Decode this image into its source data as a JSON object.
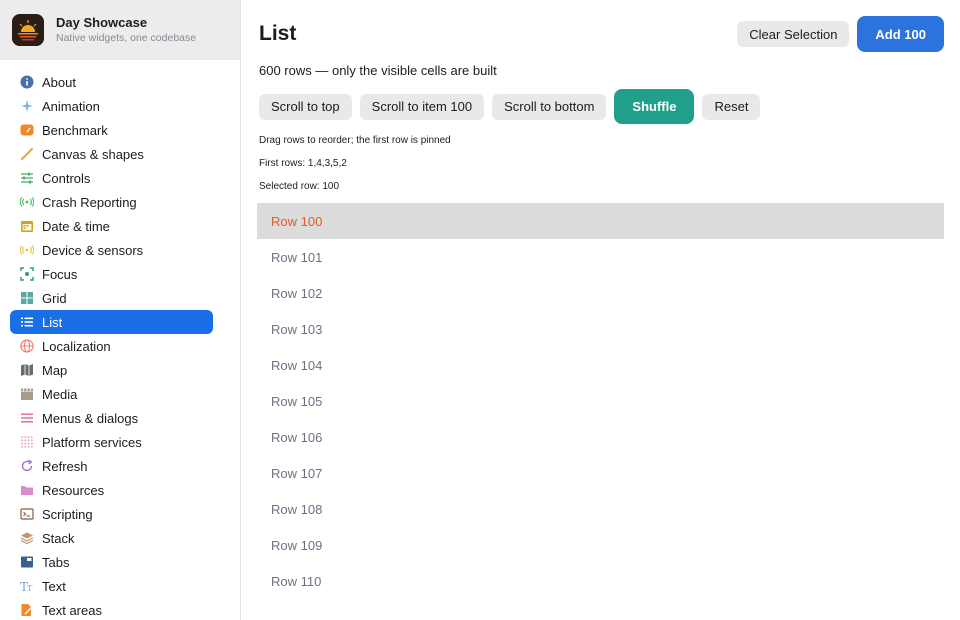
{
  "brand": {
    "title": "Day Showcase",
    "subtitle": "Native widgets, one codebase"
  },
  "sidebar": {
    "items": [
      {
        "label": "About",
        "icon": "info-icon",
        "color": "#4a6fa5"
      },
      {
        "label": "Animation",
        "icon": "sparkle-icon",
        "color": "#7fb3e8"
      },
      {
        "label": "Benchmark",
        "icon": "gauge-icon",
        "color": "#f0892b"
      },
      {
        "label": "Canvas & shapes",
        "icon": "brush-icon",
        "color": "#f0a640"
      },
      {
        "label": "Controls",
        "icon": "sliders-icon",
        "color": "#4caf6a"
      },
      {
        "label": "Crash Reporting",
        "icon": "broadcast-icon",
        "color": "#4cb85c"
      },
      {
        "label": "Date & time",
        "icon": "calendar-icon",
        "color": "#c9a227"
      },
      {
        "label": "Device & sensors",
        "icon": "sensor-icon",
        "color": "#e8c23a"
      },
      {
        "label": "Focus",
        "icon": "focus-icon",
        "color": "#2e9c8a"
      },
      {
        "label": "Grid",
        "icon": "grid-icon",
        "color": "#5aa9a0"
      },
      {
        "label": "List",
        "icon": "list-icon",
        "color": "#ffffff",
        "active": true
      },
      {
        "label": "Localization",
        "icon": "globe-icon",
        "color": "#ef7e6a"
      },
      {
        "label": "Map",
        "icon": "map-icon",
        "color": "#6b6b6b"
      },
      {
        "label": "Media",
        "icon": "clapper-icon",
        "color": "#a89a8c"
      },
      {
        "label": "Menus & dialogs",
        "icon": "menu-icon",
        "color": "#e5677f"
      },
      {
        "label": "Platform services",
        "icon": "dots-grid-icon",
        "color": "#e79bb0"
      },
      {
        "label": "Refresh",
        "icon": "refresh-icon",
        "color": "#a06cc8"
      },
      {
        "label": "Resources",
        "icon": "folder-icon",
        "color": "#d98cc9"
      },
      {
        "label": "Scripting",
        "icon": "terminal-icon",
        "color": "#8a5a3a"
      },
      {
        "label": "Stack",
        "icon": "stack-icon",
        "color": "#c4956a"
      },
      {
        "label": "Tabs",
        "icon": "tabs-icon",
        "color": "#3a5f8f"
      },
      {
        "label": "Text",
        "icon": "text-icon",
        "color": "#7aa8d8"
      },
      {
        "label": "Text areas",
        "icon": "document-edit-icon",
        "color": "#f08a2a"
      }
    ]
  },
  "main": {
    "title": "List",
    "actions": {
      "clear": "Clear Selection",
      "add": "Add 100"
    },
    "subtitle": "600 rows — only the visible cells are built",
    "controls": {
      "scroll_top": "Scroll to top",
      "scroll_item": "Scroll to item 100",
      "scroll_bottom": "Scroll to bottom",
      "shuffle": "Shuffle",
      "reset": "Reset"
    },
    "info": {
      "drag_hint": "Drag rows to reorder; the first row is pinned",
      "first_rows": "First rows: 1,4,3,5,2",
      "selected_row": "Selected row: 100"
    },
    "rows": [
      "Row 100",
      "Row 101",
      "Row 102",
      "Row 103",
      "Row 104",
      "Row 105",
      "Row 106",
      "Row 107",
      "Row 108",
      "Row 109",
      "Row 110"
    ],
    "selected_index": 0
  },
  "colors": {
    "accent": "#1a6fe6",
    "primary_button": "#2d73e0",
    "shuffle_button": "#20a08a",
    "selected_text": "#e25a24"
  }
}
